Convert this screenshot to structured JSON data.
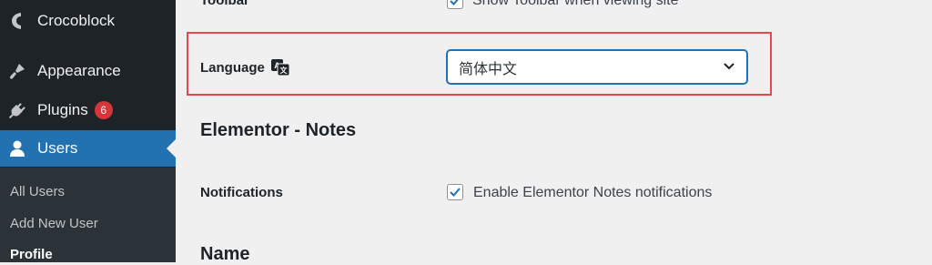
{
  "sidebar": {
    "items": [
      {
        "label": "Crocoblock",
        "icon": "crocoblock-icon"
      },
      {
        "label": "Appearance",
        "icon": "brush-icon"
      },
      {
        "label": "Plugins",
        "icon": "plug-icon",
        "badge": "6"
      },
      {
        "label": "Users",
        "icon": "user-icon",
        "current": true
      }
    ],
    "submenu": [
      {
        "label": "All Users"
      },
      {
        "label": "Add New User"
      },
      {
        "label": "Profile",
        "current": true
      }
    ]
  },
  "main": {
    "toolbar": {
      "label": "Toolbar",
      "checkbox_label": "Show Toolbar when viewing site",
      "checked": true
    },
    "language": {
      "label": "Language",
      "selected": "简体中文"
    },
    "elementor_notes": {
      "title": "Elementor - Notes",
      "notifications_label": "Notifications",
      "checkbox_label": "Enable Elementor Notes notifications",
      "checked": true
    },
    "name_section": {
      "title": "Name"
    }
  },
  "colors": {
    "accent": "#2271b1",
    "sidebar_bg": "#1d2327",
    "badge": "#d63638",
    "highlight": "#e5484d"
  }
}
